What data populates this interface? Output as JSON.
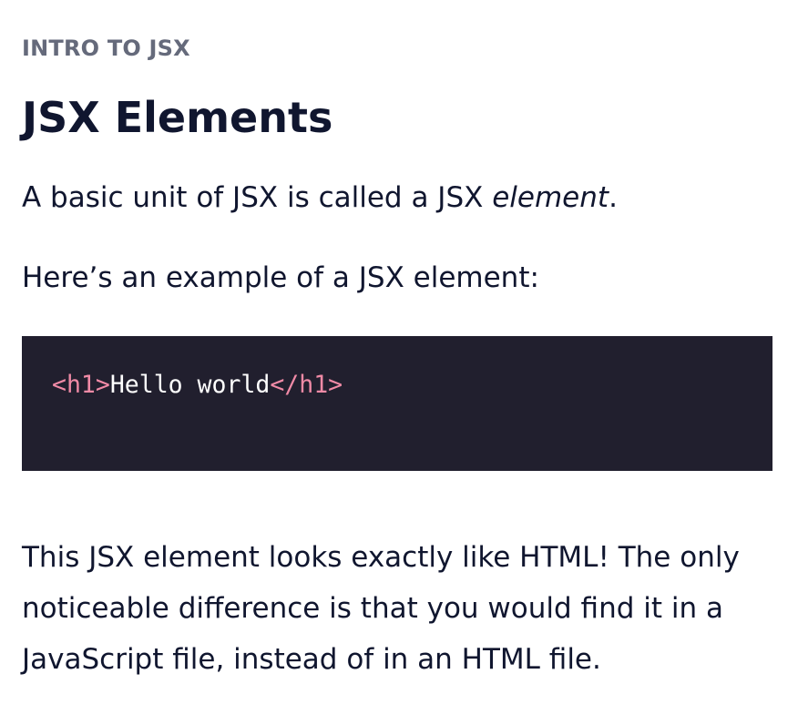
{
  "lesson": {
    "eyebrow": "INTRO TO JSX",
    "title": "JSX Elements",
    "paragraph1": {
      "before": "A basic unit of JSX is called a JSX ",
      "emphasis": "element",
      "after": "."
    },
    "paragraph2": "Here’s an example of a JSX element:",
    "code": {
      "open_tag": "<h1>",
      "text": "Hello world",
      "close_tag": "</h1>"
    },
    "paragraph3": {
      "line1": "This JSX element looks exactly like HTML! The only",
      "line2": "noticeable difference is that you would find it in a",
      "line3": "JavaScript file, instead of in an HTML file."
    }
  },
  "colors": {
    "text": "#10162f",
    "eyebrow": "#656a7b",
    "code_background": "#211f2e",
    "code_tag": "#f08aa6",
    "code_text": "#ffffff"
  }
}
